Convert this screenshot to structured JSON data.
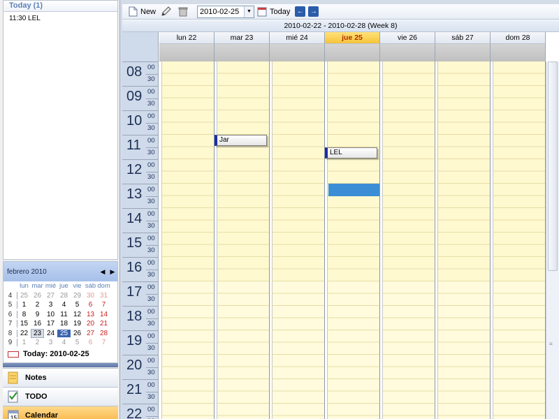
{
  "today_panel": {
    "header": "Today (1)",
    "items": [
      "11:30 LEL"
    ]
  },
  "mini_calendar": {
    "title": "febrero 2010",
    "prev_icon": "triangle-left-icon",
    "next_icon": "triangle-right-icon",
    "day_headers": [
      "lun",
      "mar",
      "mié",
      "jue",
      "vie",
      "sáb",
      "dom"
    ],
    "weeks": [
      {
        "wk": "4",
        "days": [
          "25",
          "26",
          "27",
          "28",
          "29",
          "30",
          "31"
        ]
      },
      {
        "wk": "5",
        "days": [
          "1",
          "2",
          "3",
          "4",
          "5",
          "6",
          "7"
        ]
      },
      {
        "wk": "6",
        "days": [
          "8",
          "9",
          "10",
          "11",
          "12",
          "13",
          "14"
        ]
      },
      {
        "wk": "7",
        "days": [
          "15",
          "16",
          "17",
          "18",
          "19",
          "20",
          "21"
        ]
      },
      {
        "wk": "8",
        "days": [
          "22",
          "23",
          "24",
          "25",
          "26",
          "27",
          "28"
        ]
      },
      {
        "wk": "9",
        "days": [
          "1",
          "2",
          "3",
          "4",
          "5",
          "6",
          "7"
        ]
      }
    ],
    "today_label": "Today: 2010-02-25"
  },
  "navigation": {
    "notes": "Notes",
    "todo": "TODO",
    "calendar": "Calendar"
  },
  "toolbar": {
    "new_label": "New",
    "date_value": "2010-02-25",
    "today_label": "Today"
  },
  "range": "2010-02-22  -  2010-02-28   (Week 8)",
  "days": [
    {
      "label": "lun 22",
      "today": false
    },
    {
      "label": "mar 23",
      "today": false
    },
    {
      "label": "mié 24",
      "today": false
    },
    {
      "label": "jue 25",
      "today": true
    },
    {
      "label": "vie 26",
      "today": false
    },
    {
      "label": "sáb 27",
      "today": false
    },
    {
      "label": "dom 28",
      "today": false
    }
  ],
  "hours": [
    "08",
    "09",
    "10",
    "11",
    "12",
    "13",
    "14",
    "15",
    "16",
    "17",
    "18",
    "19",
    "20",
    "21",
    "22"
  ],
  "half_labels": [
    "00",
    "30"
  ],
  "events": [
    {
      "title": "Jar",
      "day": 1,
      "start": "11:00"
    },
    {
      "title": "LEL",
      "day": 3,
      "start": "11:30"
    }
  ],
  "selection": {
    "day": 3,
    "start": "13:00",
    "end": "13:30"
  },
  "colors": {
    "work_hours": "#fff9d0",
    "after_hours": "#fffbdc",
    "accent": "#3a64b0",
    "today_header": "#f6c33a",
    "selection": "#3b8ed6",
    "event_marker": "#1a2ea0"
  }
}
